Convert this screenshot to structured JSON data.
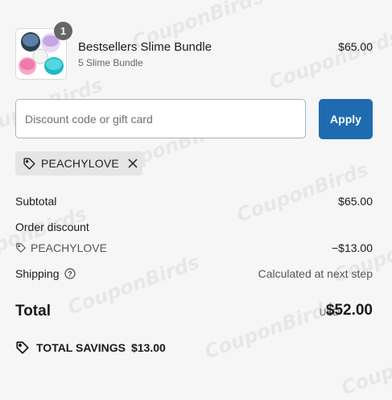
{
  "watermark": "CouponBirds",
  "product": {
    "quantity": "1",
    "title": "Bestsellers Slime Bundle",
    "subtitle": "5 Slime Bundle",
    "price": "$65.00"
  },
  "discount": {
    "placeholder": "Discount code or gift card",
    "apply_label": "Apply",
    "applied_code": "PEACHYLOVE"
  },
  "summary": {
    "subtotal_label": "Subtotal",
    "subtotal_value": "$65.00",
    "order_discount_label": "Order discount",
    "discount_code": "PEACHYLOVE",
    "discount_value": "−$13.00",
    "shipping_label": "Shipping",
    "shipping_value": "Calculated at next step",
    "total_label": "Total",
    "currency": "USD",
    "total_value": "$52.00",
    "savings_label": "TOTAL SAVINGS",
    "savings_value": "$13.00"
  },
  "colors": {
    "accent": "#1f6bb0",
    "background": "#f6f6f6"
  }
}
